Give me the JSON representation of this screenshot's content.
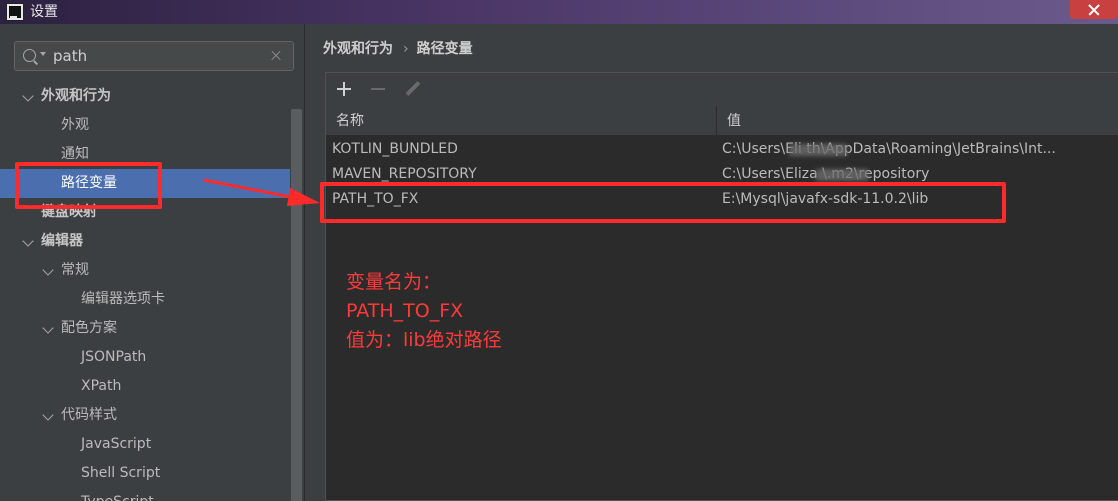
{
  "window": {
    "title": "设置"
  },
  "search": {
    "value": "path",
    "placeholder": ""
  },
  "sidebar": {
    "items": [
      {
        "label": "外观和行为",
        "level": 0,
        "expanded": true,
        "bold": true
      },
      {
        "label": "外观",
        "level": 1
      },
      {
        "label": "通知",
        "level": 1
      },
      {
        "label": "路径变量",
        "level": 1,
        "selected": true
      },
      {
        "label": "键盘映射",
        "level": 0,
        "bold": true
      },
      {
        "label": "编辑器",
        "level": 0,
        "expanded": true,
        "bold": true
      },
      {
        "label": "常规",
        "level": 1,
        "expanded": true
      },
      {
        "label": "编辑器选项卡",
        "level": 2
      },
      {
        "label": "配色方案",
        "level": 1,
        "expanded": true
      },
      {
        "label": "JSONPath",
        "level": 2
      },
      {
        "label": "XPath",
        "level": 2
      },
      {
        "label": "代码样式",
        "level": 1,
        "expanded": true
      },
      {
        "label": "JavaScript",
        "level": 2
      },
      {
        "label": "Shell Script",
        "level": 2
      },
      {
        "label": "TypeScript",
        "level": 2
      }
    ]
  },
  "breadcrumb": {
    "parent": "外观和行为",
    "separator": "›",
    "current": "路径变量"
  },
  "toolbar": {
    "add_icon": "plus-icon",
    "remove_icon": "minus-icon",
    "edit_icon": "pencil-icon"
  },
  "table": {
    "columns": [
      "名称",
      "值"
    ],
    "rows": [
      {
        "name": "KOTLIN_BUNDLED",
        "value": "C:\\Users\\Eli      th\\AppData\\Roaming\\JetBrains\\Int..."
      },
      {
        "name": "MAVEN_REPOSITORY",
        "value": "C:\\Users\\Eliza       \\.m2\\repository"
      },
      {
        "name": "PATH_TO_FX",
        "value": "E:\\Mysql\\javafx-sdk-11.0.2\\lib"
      }
    ]
  },
  "annotation": {
    "line1": "变量名为：",
    "line2": "PATH_TO_FX",
    "line3": "值为：lib绝对路径",
    "color": "#ff2a2a"
  },
  "colors": {
    "selection": "#4b6eaf",
    "background": "#3c3f41",
    "table_bg": "#2b2b2b"
  }
}
